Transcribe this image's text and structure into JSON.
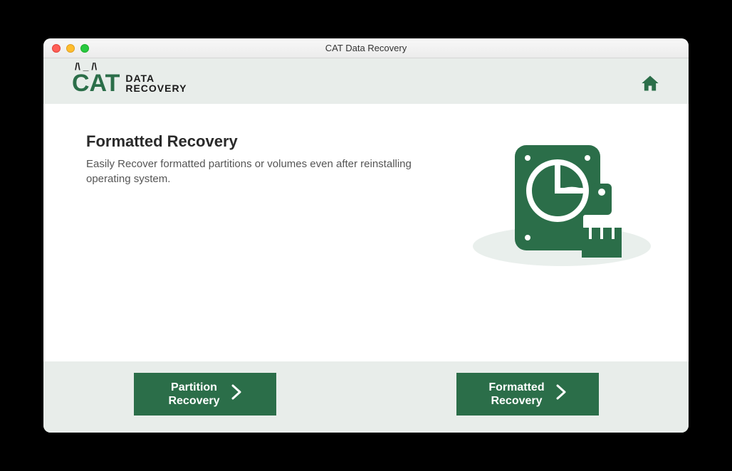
{
  "window": {
    "title": "CAT Data Recovery"
  },
  "header": {
    "logo_main": "CAT",
    "logo_line1": "DATA",
    "logo_line2": "RECOVERY"
  },
  "main": {
    "title": "Formatted Recovery",
    "description": "Easily Recover formatted partitions or volumes even after reinstalling operating system."
  },
  "footer": {
    "buttons": [
      {
        "line1": "Partition",
        "line2": "Recovery"
      },
      {
        "line1": "Formatted",
        "line2": "Recovery"
      }
    ]
  },
  "colors": {
    "brand": "#2b6e49",
    "panel": "#e8edea"
  }
}
